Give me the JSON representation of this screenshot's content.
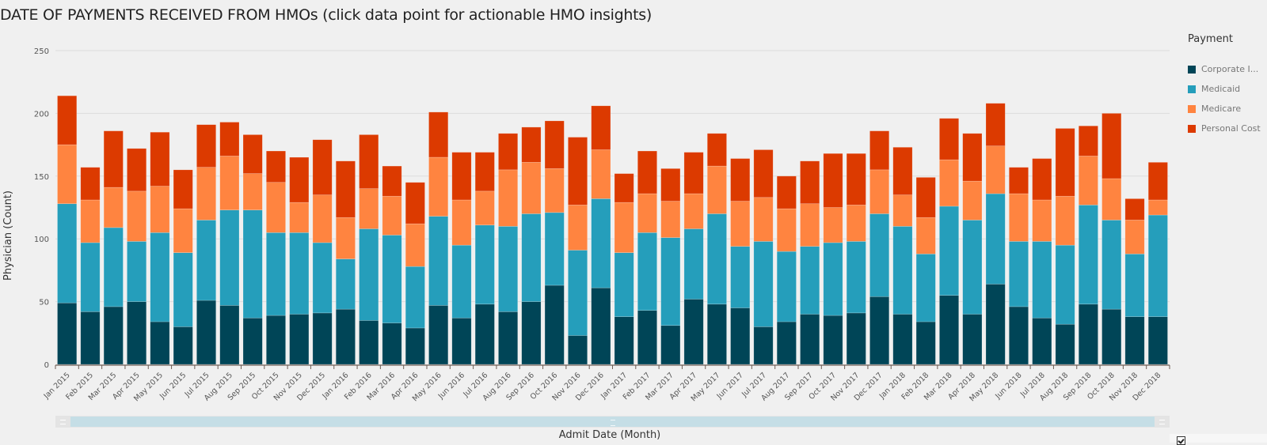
{
  "title": "DATE OF PAYMENTS RECEIVED FROM HMOs (click data point for actionable HMO insights)",
  "legend": {
    "title": "Payment",
    "items": [
      {
        "label": "Corporate I...",
        "color": "#004557"
      },
      {
        "label": "Medicaid",
        "color": "#259ebb"
      },
      {
        "label": "Medicare",
        "color": "#ff8440"
      },
      {
        "label": "Personal Cost",
        "color": "#dc3a00"
      }
    ]
  },
  "chart_data": {
    "type": "bar",
    "stacked": true,
    "title": "DATE OF PAYMENTS RECEIVED FROM HMOs (click data point for actionable HMO insights)",
    "xlabel": "Admit Date (Month)",
    "ylabel": "Physician (Count)",
    "ylim": [
      0,
      250
    ],
    "yticks": [
      0,
      50,
      100,
      150,
      200,
      250
    ],
    "grid": true,
    "legend_title": "Payment",
    "legend_position": "right",
    "categories": [
      "Jan 2015",
      "Feb 2015",
      "Mar 2015",
      "Apr 2015",
      "May 2015",
      "Jun 2015",
      "Jul 2015",
      "Aug 2015",
      "Sep 2015",
      "Oct 2015",
      "Nov 2015",
      "Dec 2015",
      "Jan 2016",
      "Feb 2016",
      "Mar 2016",
      "Apr 2016",
      "May 2016",
      "Jun 2016",
      "Jul 2016",
      "Aug 2016",
      "Sep 2016",
      "Oct 2016",
      "Nov 2016",
      "Dec 2016",
      "Jan 2017",
      "Feb 2017",
      "Mar 2017",
      "Apr 2017",
      "May 2017",
      "Jun 2017",
      "Jul 2017",
      "Aug 2017",
      "Sep 2017",
      "Oct 2017",
      "Nov 2017",
      "Dec 2017",
      "Jan 2018",
      "Feb 2018",
      "Mar 2018",
      "Apr 2018",
      "May 2018",
      "Jun 2018",
      "Jul 2018",
      "Aug 2018",
      "Sep 2018",
      "Oct 2018",
      "Nov 2018",
      "Dec 2018"
    ],
    "series": [
      {
        "name": "Corporate I...",
        "color": "#004557",
        "values": [
          49,
          42,
          46,
          50,
          34,
          30,
          51,
          47,
          37,
          39,
          40,
          41,
          44,
          35,
          33,
          29,
          47,
          37,
          48,
          42,
          50,
          63,
          23,
          61,
          38,
          43,
          31,
          52,
          48,
          45,
          30,
          34,
          40,
          39,
          41,
          54,
          40,
          34,
          55,
          40,
          64,
          46,
          37,
          32,
          48,
          44,
          38,
          38
        ]
      },
      {
        "name": "Medicaid",
        "color": "#259ebb",
        "values": [
          79,
          55,
          63,
          48,
          71,
          59,
          64,
          76,
          86,
          66,
          65,
          56,
          40,
          73,
          70,
          49,
          71,
          58,
          63,
          68,
          70,
          58,
          68,
          71,
          51,
          62,
          70,
          56,
          72,
          49,
          68,
          56,
          54,
          58,
          57,
          66,
          70,
          54,
          71,
          75,
          72,
          52,
          61,
          63,
          79,
          71,
          50,
          81
        ]
      },
      {
        "name": "Medicare",
        "color": "#ff8440",
        "values": [
          47,
          34,
          32,
          40,
          37,
          35,
          42,
          43,
          29,
          40,
          24,
          38,
          33,
          32,
          31,
          34,
          47,
          36,
          27,
          45,
          41,
          35,
          36,
          39,
          40,
          31,
          29,
          28,
          38,
          36,
          35,
          34,
          34,
          28,
          29,
          35,
          25,
          29,
          37,
          31,
          38,
          38,
          33,
          39,
          39,
          33,
          27,
          12
        ]
      },
      {
        "name": "Personal Cost",
        "color": "#dc3a00",
        "values": [
          39,
          26,
          45,
          34,
          43,
          31,
          34,
          27,
          31,
          25,
          36,
          44,
          45,
          43,
          24,
          33,
          36,
          38,
          31,
          29,
          28,
          38,
          54,
          35,
          23,
          34,
          26,
          33,
          26,
          34,
          38,
          26,
          34,
          43,
          41,
          31,
          38,
          32,
          33,
          38,
          34,
          21,
          33,
          54,
          24,
          52,
          17,
          30
        ]
      }
    ]
  },
  "scrollbar": {
    "visible_fraction": 1.0
  }
}
